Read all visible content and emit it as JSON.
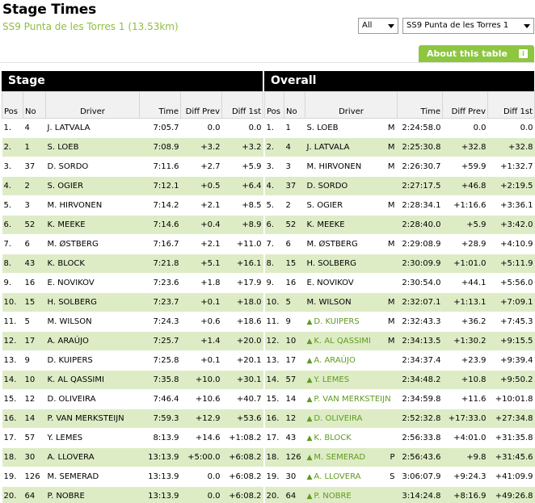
{
  "page": {
    "title": "Stage Times",
    "subtitle": "SS9 Punta de les Torres 1 (13.53km)",
    "filter_selected": "All",
    "stage_selected": "SS9 Punta de les Torres 1",
    "about_label": "About this table",
    "info_glyph": "i"
  },
  "stage": {
    "heading": "Stage",
    "columns": [
      "Pos",
      "No",
      "Driver",
      "Time",
      "Diff Prev",
      "Diff 1st"
    ],
    "rows": [
      {
        "pos": "1.",
        "no": "4",
        "driver": "J. LATVALA",
        "time": "7:05.7",
        "prev": "0.0",
        "first": "0.0"
      },
      {
        "pos": "2.",
        "no": "1",
        "driver": "S. LOEB",
        "time": "7:08.9",
        "prev": "+3.2",
        "first": "+3.2"
      },
      {
        "pos": "3.",
        "no": "37",
        "driver": "D. SORDO",
        "time": "7:11.6",
        "prev": "+2.7",
        "first": "+5.9"
      },
      {
        "pos": "4.",
        "no": "2",
        "driver": "S. OGIER",
        "time": "7:12.1",
        "prev": "+0.5",
        "first": "+6.4"
      },
      {
        "pos": "5.",
        "no": "3",
        "driver": "M. HIRVONEN",
        "time": "7:14.2",
        "prev": "+2.1",
        "first": "+8.5"
      },
      {
        "pos": "6.",
        "no": "52",
        "driver": "K. MEEKE",
        "time": "7:14.6",
        "prev": "+0.4",
        "first": "+8.9"
      },
      {
        "pos": "7.",
        "no": "6",
        "driver": "M. ØSTBERG",
        "time": "7:16.7",
        "prev": "+2.1",
        "first": "+11.0"
      },
      {
        "pos": "8.",
        "no": "43",
        "driver": "K. BLOCK",
        "time": "7:21.8",
        "prev": "+5.1",
        "first": "+16.1"
      },
      {
        "pos": "9.",
        "no": "16",
        "driver": "E. NOVIKOV",
        "time": "7:23.6",
        "prev": "+1.8",
        "first": "+17.9"
      },
      {
        "pos": "10.",
        "no": "15",
        "driver": "H. SOLBERG",
        "time": "7:23.7",
        "prev": "+0.1",
        "first": "+18.0"
      },
      {
        "pos": "11.",
        "no": "5",
        "driver": "M. WILSON",
        "time": "7:24.3",
        "prev": "+0.6",
        "first": "+18.6"
      },
      {
        "pos": "12.",
        "no": "17",
        "driver": "A. ARAÚJO",
        "time": "7:25.7",
        "prev": "+1.4",
        "first": "+20.0"
      },
      {
        "pos": "13.",
        "no": "9",
        "driver": "D. KUIPERS",
        "time": "7:25.8",
        "prev": "+0.1",
        "first": "+20.1"
      },
      {
        "pos": "14.",
        "no": "10",
        "driver": "K. AL QASSIMI",
        "time": "7:35.8",
        "prev": "+10.0",
        "first": "+30.1"
      },
      {
        "pos": "15.",
        "no": "12",
        "driver": "D. OLIVEIRA",
        "time": "7:46.4",
        "prev": "+10.6",
        "first": "+40.7"
      },
      {
        "pos": "16.",
        "no": "14",
        "driver": "P. VAN MERKSTEIJN",
        "time": "7:59.3",
        "prev": "+12.9",
        "first": "+53.6"
      },
      {
        "pos": "17.",
        "no": "57",
        "driver": "Y. LEMES",
        "time": "8:13.9",
        "prev": "+14.6",
        "first": "+1:08.2"
      },
      {
        "pos": "18.",
        "no": "30",
        "driver": "A. LLOVERA",
        "time": "13:13.9",
        "prev": "+5:00.0",
        "first": "+6:08.2"
      },
      {
        "pos": "19.",
        "no": "126",
        "driver": "M. SEMERAD",
        "time": "13:13.9",
        "prev": "0.0",
        "first": "+6:08.2"
      },
      {
        "pos": "20.",
        "no": "64",
        "driver": "P. NOBRE",
        "time": "13:13.9",
        "prev": "0.0",
        "first": "+6:08.2"
      }
    ]
  },
  "overall": {
    "heading": "Overall",
    "columns": [
      "Pos",
      "No",
      "Driver",
      "Time",
      "Diff Prev",
      "Diff 1st"
    ],
    "up_arrow": "🡅",
    "rows": [
      {
        "pos": "1.",
        "no": "1",
        "driver": "S. LOEB",
        "up": false,
        "cls": "M",
        "time": "2:24:58.0",
        "prev": "0.0",
        "first": "0.0"
      },
      {
        "pos": "2.",
        "no": "4",
        "driver": "J. LATVALA",
        "up": false,
        "cls": "M",
        "time": "2:25:30.8",
        "prev": "+32.8",
        "first": "+32.8"
      },
      {
        "pos": "3.",
        "no": "3",
        "driver": "M. HIRVONEN",
        "up": false,
        "cls": "M",
        "time": "2:26:30.7",
        "prev": "+59.9",
        "first": "+1:32.7"
      },
      {
        "pos": "4.",
        "no": "37",
        "driver": "D. SORDO",
        "up": false,
        "cls": "",
        "time": "2:27:17.5",
        "prev": "+46.8",
        "first": "+2:19.5"
      },
      {
        "pos": "5.",
        "no": "2",
        "driver": "S. OGIER",
        "up": false,
        "cls": "M",
        "time": "2:28:34.1",
        "prev": "+1:16.6",
        "first": "+3:36.1"
      },
      {
        "pos": "6.",
        "no": "52",
        "driver": "K. MEEKE",
        "up": false,
        "cls": "",
        "time": "2:28:40.0",
        "prev": "+5.9",
        "first": "+3:42.0"
      },
      {
        "pos": "7.",
        "no": "6",
        "driver": "M. ØSTBERG",
        "up": false,
        "cls": "M",
        "time": "2:29:08.9",
        "prev": "+28.9",
        "first": "+4:10.9"
      },
      {
        "pos": "8.",
        "no": "15",
        "driver": "H. SOLBERG",
        "up": false,
        "cls": "",
        "time": "2:30:09.9",
        "prev": "+1:01.0",
        "first": "+5:11.9"
      },
      {
        "pos": "9.",
        "no": "16",
        "driver": "E. NOVIKOV",
        "up": false,
        "cls": "",
        "time": "2:30:54.0",
        "prev": "+44.1",
        "first": "+5:56.0"
      },
      {
        "pos": "10.",
        "no": "5",
        "driver": "M. WILSON",
        "up": false,
        "cls": "M",
        "time": "2:32:07.1",
        "prev": "+1:13.1",
        "first": "+7:09.1"
      },
      {
        "pos": "11.",
        "no": "9",
        "driver": "D. KUIPERS",
        "up": true,
        "cls": "M",
        "time": "2:32:43.3",
        "prev": "+36.2",
        "first": "+7:45.3"
      },
      {
        "pos": "12.",
        "no": "10",
        "driver": "K. AL QASSIMI",
        "up": true,
        "cls": "M",
        "time": "2:34:13.5",
        "prev": "+1:30.2",
        "first": "+9:15.5"
      },
      {
        "pos": "13.",
        "no": "17",
        "driver": "A. ARAÚJO",
        "up": true,
        "cls": "",
        "time": "2:34:37.4",
        "prev": "+23.9",
        "first": "+9:39.4"
      },
      {
        "pos": "14.",
        "no": "57",
        "driver": "Y. LEMES",
        "up": true,
        "cls": "",
        "time": "2:34:48.2",
        "prev": "+10.8",
        "first": "+9:50.2"
      },
      {
        "pos": "15.",
        "no": "14",
        "driver": "P. VAN MERKSTEIJN",
        "up": true,
        "cls": "",
        "time": "2:34:59.8",
        "prev": "+11.6",
        "first": "+10:01.8"
      },
      {
        "pos": "16.",
        "no": "12",
        "driver": "D. OLIVEIRA",
        "up": true,
        "cls": "",
        "time": "2:52:32.8",
        "prev": "+17:33.0",
        "first": "+27:34.8"
      },
      {
        "pos": "17.",
        "no": "43",
        "driver": "K. BLOCK",
        "up": true,
        "cls": "",
        "time": "2:56:33.8",
        "prev": "+4:01.0",
        "first": "+31:35.8"
      },
      {
        "pos": "18.",
        "no": "126",
        "driver": "M. SEMERAD",
        "up": true,
        "cls": "P",
        "time": "2:56:43.6",
        "prev": "+9.8",
        "first": "+31:45.6"
      },
      {
        "pos": "19.",
        "no": "30",
        "driver": "A. LLOVERA",
        "up": true,
        "cls": "S",
        "time": "3:06:07.9",
        "prev": "+9:24.3",
        "first": "+41:09.9"
      },
      {
        "pos": "20.",
        "no": "64",
        "driver": "P. NOBRE",
        "up": true,
        "cls": "",
        "time": "3:14:24.8",
        "prev": "+8:16.9",
        "first": "+49:26.8"
      }
    ]
  }
}
